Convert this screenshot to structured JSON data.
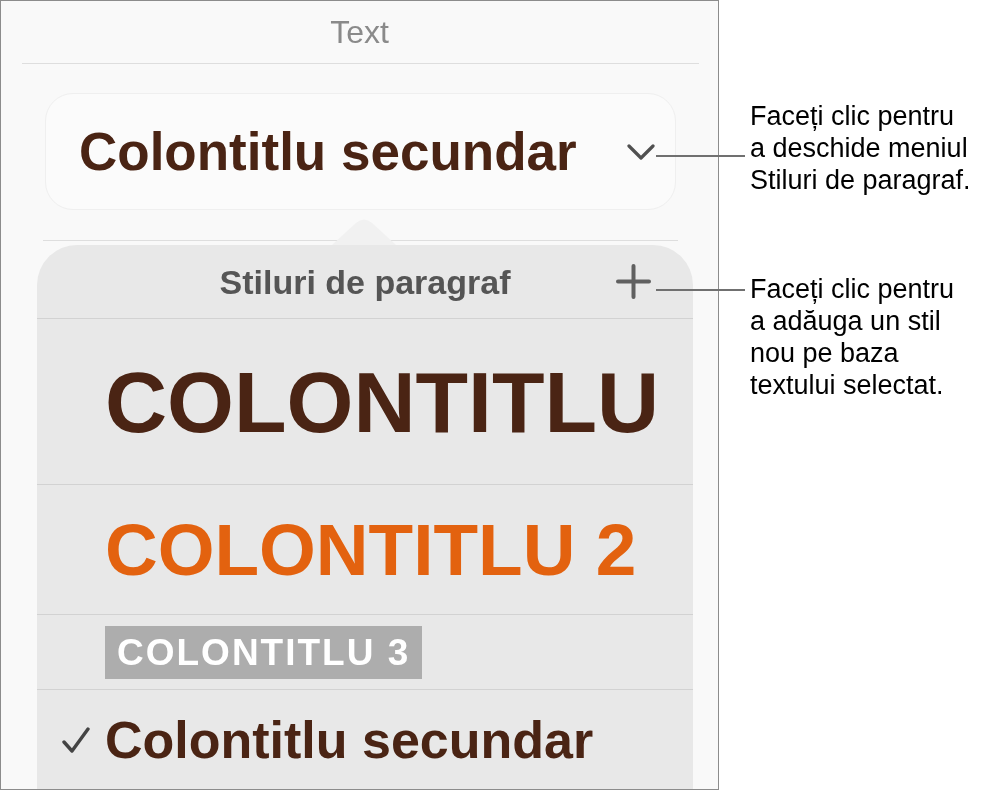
{
  "panel": {
    "title": "Text"
  },
  "style_dropdown": {
    "value": "Colontitlu secundar"
  },
  "popover": {
    "title": "Stiluri de paragraf",
    "styles": [
      {
        "label": "COLONTITLU",
        "kind": "heading",
        "selected": false
      },
      {
        "label": "COLONTITLU 2",
        "kind": "heading_2",
        "selected": false
      },
      {
        "label": "COLONTITLU 3",
        "kind": "heading_3",
        "selected": false
      },
      {
        "label": "Colontitlu secundar",
        "kind": "subheading",
        "selected": true
      }
    ]
  },
  "callouts": [
    {
      "text": "Faceți clic pentru\na deschide meniul\nStiluri de paragraf."
    },
    {
      "text": "Faceți clic pentru\na adăuga un stil\nnou pe baza\ntextului selectat."
    }
  ]
}
